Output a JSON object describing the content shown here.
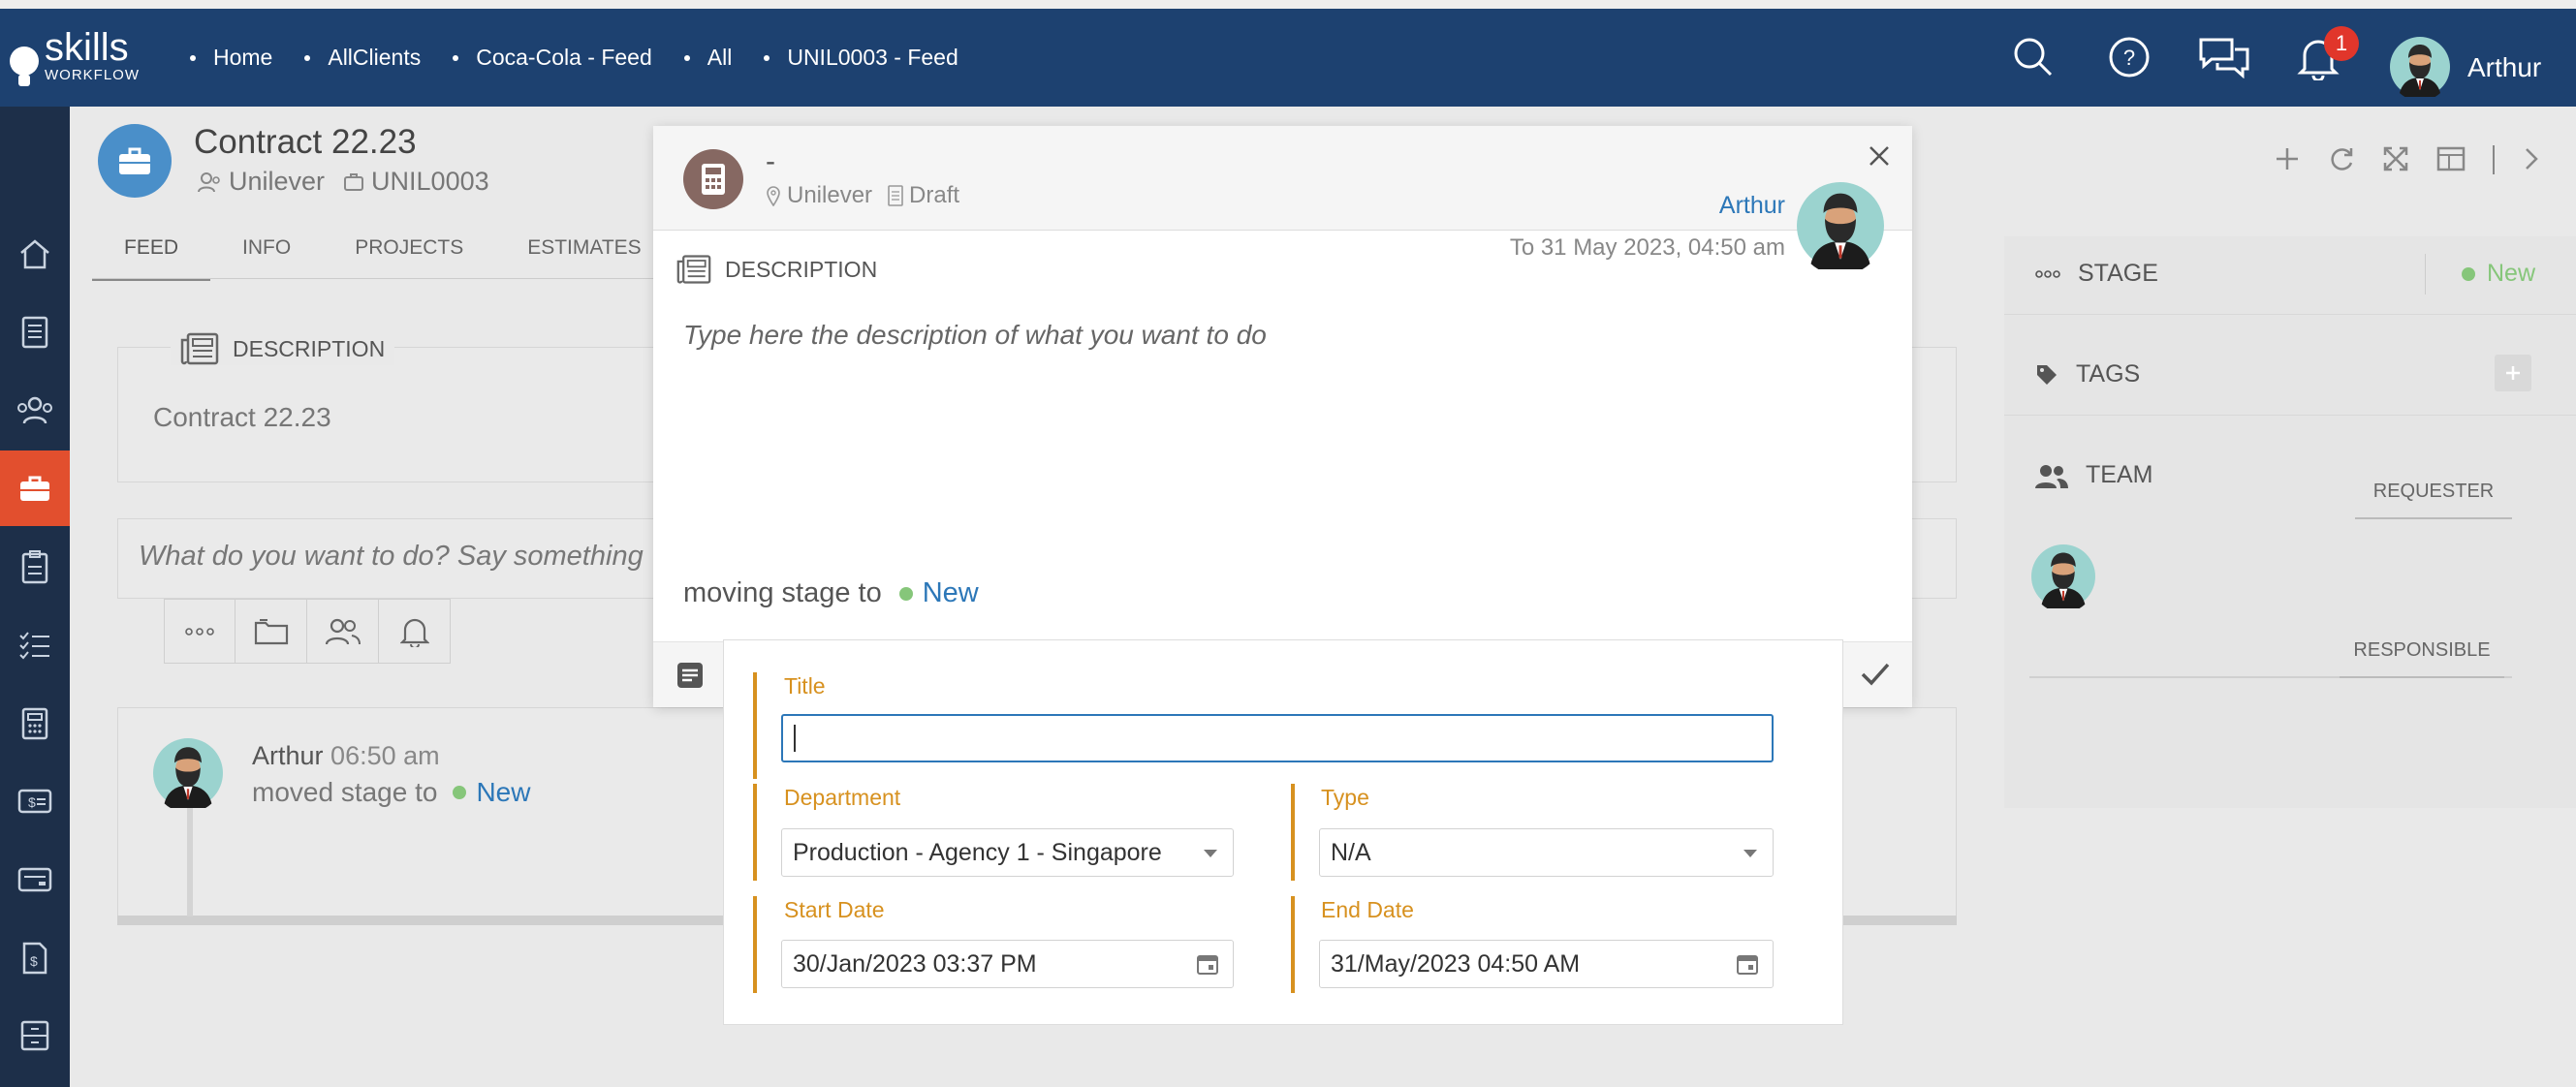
{
  "brand": {
    "name": "skills",
    "sub": "WORKFLOW"
  },
  "breadcrumbs": [
    "Home",
    "AllClients",
    "Coca-Cola - Feed",
    "All",
    "UNIL0003 - Feed"
  ],
  "header": {
    "notification_count": "1",
    "user_name": "Arthur"
  },
  "contract": {
    "title": "Contract 22.23",
    "client": "Unilever",
    "code": "UNIL0003"
  },
  "tabs": [
    "FEED",
    "INFO",
    "PROJECTS",
    "ESTIMATES"
  ],
  "description_card": {
    "label": "DESCRIPTION",
    "text": "Contract 22.23"
  },
  "composer": {
    "placeholder": "What do you want to do? Say something"
  },
  "feed_entry": {
    "author": "Arthur",
    "time": "06:50 am",
    "action": "moved stage to",
    "stage": "New"
  },
  "right_panel": {
    "stage_label": "STAGE",
    "stage_value": "New",
    "tags_label": "TAGS",
    "team_label": "TEAM",
    "requester_label": "REQUESTER",
    "responsible_label": "RESPONSIBLE"
  },
  "modal": {
    "title": "-",
    "client": "Unilever",
    "status": "Draft",
    "author": "Arthur",
    "date": "To 31 May 2023, 04:50 am",
    "description_label": "DESCRIPTION",
    "description_placeholder": "Type here the description of what you want to do",
    "moving_text": "moving stage to",
    "moving_stage": "New"
  },
  "form": {
    "title_label": "Title",
    "title_value": "",
    "department_label": "Department",
    "department_value": "Production - Agency 1 - Singapore",
    "type_label": "Type",
    "type_value": "N/A",
    "start_label": "Start Date",
    "start_value": "30/Jan/2023 03:37 PM",
    "end_label": "End Date",
    "end_value": "31/May/2023 04:50 AM"
  },
  "colors": {
    "topbar": "#1d4170",
    "sidebar": "#1d2f49",
    "active": "#e24f2e",
    "accent": "#2c77b8",
    "field_accent": "#d7911f",
    "stage_new": "#86c67a"
  }
}
